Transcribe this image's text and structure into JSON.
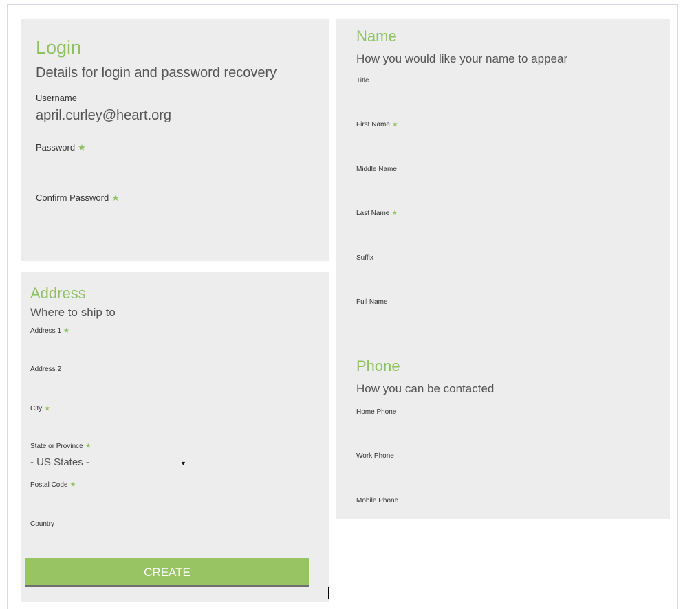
{
  "login": {
    "heading": "Login",
    "subheading": "Details for login and password recovery",
    "username_label": "Username",
    "username_value": "april.curley@heart.org",
    "password_label": "Password",
    "confirm_password_label": "Confirm Password"
  },
  "address": {
    "heading": "Address",
    "subheading": "Where to ship to",
    "address1_label": "Address 1",
    "address2_label": "Address 2",
    "city_label": "City",
    "state_label": "State or Province",
    "state_selected": "- US States -",
    "postal_label": "Postal Code",
    "country_label": "Country"
  },
  "name": {
    "heading": "Name",
    "subheading": "How you would like your name to appear",
    "title_label": "Title",
    "first_name_label": "First Name",
    "middle_name_label": "Middle Name",
    "last_name_label": "Last Name",
    "suffix_label": "Suffix",
    "full_name_label": "Full Name"
  },
  "phone": {
    "heading": "Phone",
    "subheading": "How you can be contacted",
    "home_label": "Home Phone",
    "work_label": "Work Phone",
    "mobile_label": "Mobile Phone"
  },
  "actions": {
    "create_label": "CREATE"
  },
  "icons": {
    "required": "star-icon"
  },
  "colors": {
    "accent": "#8fc163",
    "button": "#98c464",
    "panel": "#ededed"
  }
}
